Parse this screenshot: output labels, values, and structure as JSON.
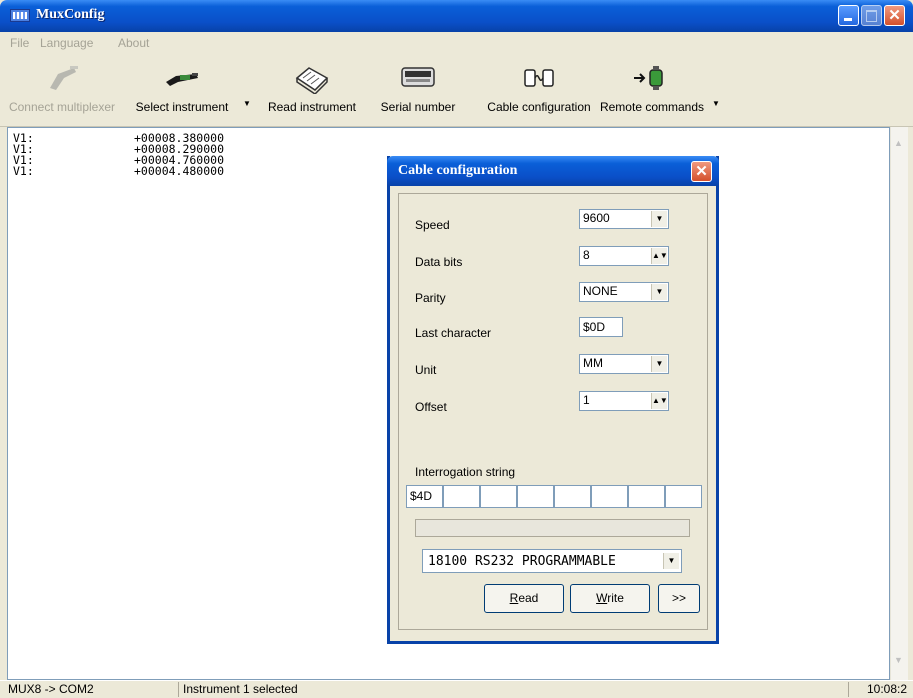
{
  "window": {
    "title": "MuxConfig"
  },
  "menu": {
    "file": "File",
    "language": "Language",
    "about": "About"
  },
  "toolbar": {
    "connect": "Connect multiplexer",
    "select": "Select instrument",
    "read": "Read instrument",
    "serial": "Serial number",
    "cable": "Cable configuration",
    "remote": "Remote commands"
  },
  "output": {
    "lines": [
      {
        "label": "V1:",
        "value": "+00008.380000"
      },
      {
        "label": "V1:",
        "value": "+00008.290000"
      },
      {
        "label": "V1:",
        "value": "+00004.760000"
      },
      {
        "label": "V1:",
        "value": "+00004.480000"
      }
    ]
  },
  "dialog": {
    "title": "Cable configuration",
    "speed": {
      "label": "Speed",
      "value": "9600"
    },
    "data_bits": {
      "label": "Data bits",
      "value": "8"
    },
    "parity": {
      "label": "Parity",
      "value": "NONE"
    },
    "last_char": {
      "label": "Last character",
      "value": "$0D"
    },
    "unit": {
      "label": "Unit",
      "value": "MM"
    },
    "offset": {
      "label": "Offset",
      "value": "1"
    },
    "interrogation": {
      "label": "Interrogation string",
      "cells": [
        "$4D",
        "",
        "",
        "",
        "",
        "",
        "",
        ""
      ]
    },
    "mode": "18100 RS232 PROGRAMMABLE",
    "read_btn": {
      "first": "R",
      "rest": "ead"
    },
    "write_btn": {
      "first": "W",
      "rest": "rite"
    },
    "more_btn": ">>"
  },
  "status": {
    "port": "MUX8 -> COM2",
    "message": "Instrument 1 selected",
    "time": "10:08:2"
  },
  "colors": {
    "titlebar": "#0a4fc8",
    "close": "#d4502c",
    "face": "#ece9d8"
  }
}
